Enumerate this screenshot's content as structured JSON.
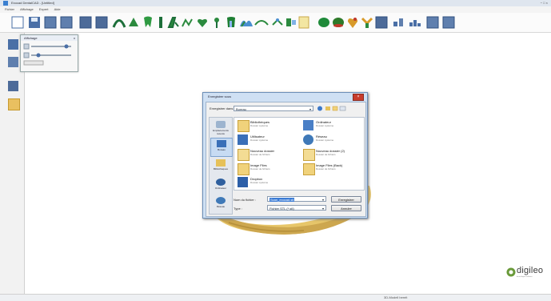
{
  "window": {
    "title": "Exocad DentalCAD - [Untitled]",
    "controls": "− □ ×"
  },
  "menu": [
    "Fichier",
    "Affichage",
    "Expert",
    "Aide"
  ],
  "panel": {
    "title": "Affichage",
    "close": "x"
  },
  "dialog": {
    "title": "Enregistrer sous",
    "close": "×",
    "save_in_label": "Enregistrer dans :",
    "save_in_value": "Bureau",
    "places": [
      {
        "label": "Emplacements récents",
        "icon": "recent-icon"
      },
      {
        "label": "Bureau",
        "icon": "desktop-icon"
      },
      {
        "label": "Bibliothèques",
        "icon": "libraries-icon"
      },
      {
        "label": "Ordinateur",
        "icon": "computer-icon"
      },
      {
        "label": "Réseau",
        "icon": "network-icon"
      }
    ],
    "files": [
      {
        "name": "Bibliothèques",
        "desc": "Dossier système",
        "icon": "folder-icon"
      },
      {
        "name": "Ordinateur",
        "desc": "Dossier système",
        "icon": "computer-icon"
      },
      {
        "name": "Utilisateur",
        "desc": "Dossier système",
        "icon": "user-folder-icon"
      },
      {
        "name": "Réseau",
        "desc": "Dossier système",
        "icon": "network-icon"
      },
      {
        "name": "Nouveau dossier",
        "desc": "Dossier de fichiers",
        "icon": "file-folder-icon"
      },
      {
        "name": "Nouveau dossier (2)",
        "desc": "Dossier de fichiers",
        "icon": "file-folder-icon"
      },
      {
        "name": "Image Files",
        "desc": "Dossier de fichiers",
        "icon": "image-folder-icon"
      },
      {
        "name": "Image Files (Back)",
        "desc": "Dossier de fichiers",
        "icon": "image-folder-icon"
      },
      {
        "name": "Dropbox",
        "desc": "Dossier système",
        "icon": "dropbox-icon"
      }
    ],
    "filename_label": "Nom du fichier :",
    "filename_value": "Scan_exocad.stl",
    "type_label": "Type :",
    "type_value": "Fichier STL (*.stl)",
    "save_button": "Enregistrer",
    "cancel_button": "Annuler"
  },
  "logo": {
    "text": "digileo",
    "sub": "dental digital solutions"
  },
  "status": {
    "right": "3D-Modell bereit"
  },
  "colors": {
    "accent": "#1d6f3a",
    "toolbar_blue": "#4a6fa6",
    "dialog_frame": "#cfe0f3"
  }
}
